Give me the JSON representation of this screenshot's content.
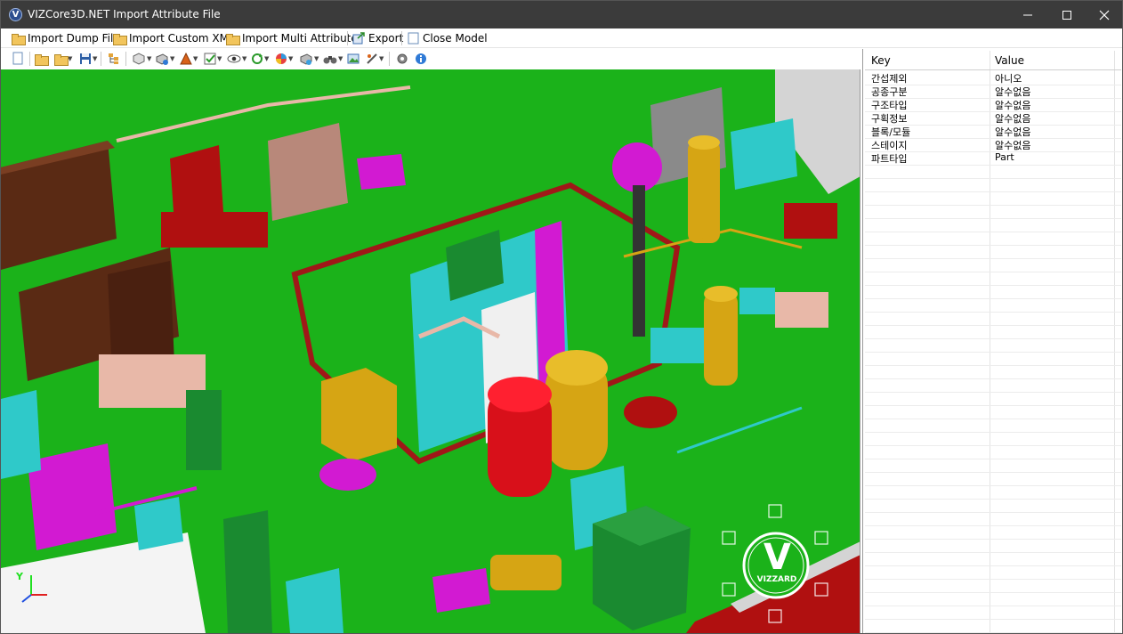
{
  "window": {
    "title": "VIZCore3D.NET Import Attribute File",
    "icon_letter": "V"
  },
  "menu": {
    "items": [
      {
        "label": "Import Dump File"
      },
      {
        "label": "Import Custom XML"
      },
      {
        "label": "Import Multi Attribute"
      },
      {
        "label": "Export"
      },
      {
        "label": "Close Model"
      }
    ]
  },
  "toolbar": {
    "icons": [
      "new-icon",
      "open-icon",
      "open-recent-icon",
      "save-icon",
      "tree-icon",
      "select-box-icon",
      "view-icon",
      "color-icon",
      "check-icon",
      "eye-icon",
      "rotate-icon",
      "render-mode-icon",
      "camera-icon",
      "binoculars-icon",
      "image-icon",
      "measure-icon",
      "settings-icon",
      "info-icon"
    ]
  },
  "viewport": {
    "logo_text": "VIZZARD",
    "logo_letter": "V",
    "axis_label_y": "Y",
    "colors": {
      "background": "#1bb21a",
      "deck_red": "#b01010",
      "tank_yellow": "#d6a514",
      "cyan": "#2fc9c9",
      "magenta": "#d21ad2",
      "brown": "#5a2a14",
      "pink": "#e8b8a8"
    }
  },
  "attributes": {
    "header": {
      "key": "Key",
      "value": "Value"
    },
    "rows": [
      {
        "key": "간섭제외",
        "value": "아니오"
      },
      {
        "key": "공종구분",
        "value": "알수없음"
      },
      {
        "key": "구조타입",
        "value": "알수없음"
      },
      {
        "key": "구획정보",
        "value": "알수없음"
      },
      {
        "key": "블록/모듈",
        "value": "알수없음"
      },
      {
        "key": "스테이지",
        "value": "알수없음"
      },
      {
        "key": "파트타입",
        "value": "Part"
      }
    ]
  }
}
